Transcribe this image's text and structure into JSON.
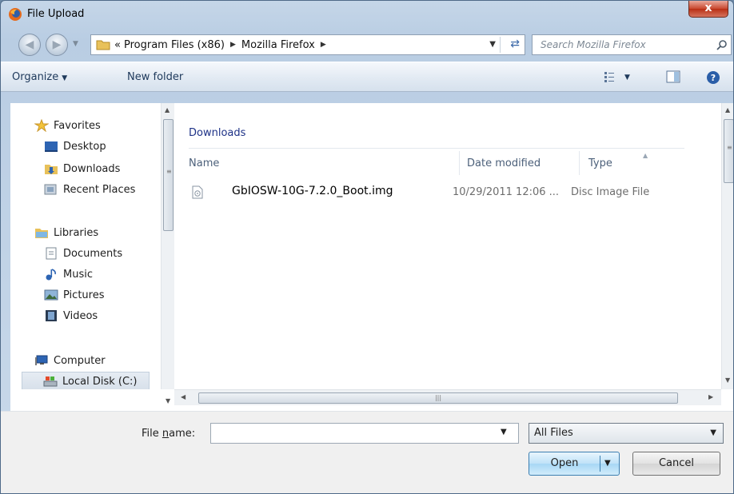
{
  "window": {
    "title": "File Upload",
    "close_label": "x"
  },
  "address": {
    "overflow": "«",
    "crumbs": [
      "Program Files (x86)",
      "Mozilla Firefox"
    ],
    "search_placeholder": "Search Mozilla Firefox"
  },
  "toolbar": {
    "organize_label": "Organize",
    "new_folder_label": "New folder"
  },
  "nav": {
    "favorites": "Favorites",
    "desktop": "Desktop",
    "downloads": "Downloads",
    "recent_places": "Recent Places",
    "libraries": "Libraries",
    "documents": "Documents",
    "music": "Music",
    "pictures": "Pictures",
    "videos": "Videos",
    "computer": "Computer",
    "local_disk": "Local Disk (C:)"
  },
  "files": {
    "group": "Downloads",
    "columns": {
      "name": "Name",
      "date": "Date modified",
      "type": "Type"
    },
    "rows": [
      {
        "name": "GbIOSW-10G-7.2.0_Boot.img",
        "date": "10/29/2011 12:06 ...",
        "type": "Disc Image File"
      }
    ]
  },
  "form": {
    "filename_label_pre": "File ",
    "filename_label_key": "n",
    "filename_label_post": "ame:",
    "filename_value": "",
    "filter_value": "All Files",
    "open_label": "Open",
    "cancel_label": "Cancel"
  },
  "colors": {
    "accent": "#1e3287",
    "close": "#c8472e"
  }
}
